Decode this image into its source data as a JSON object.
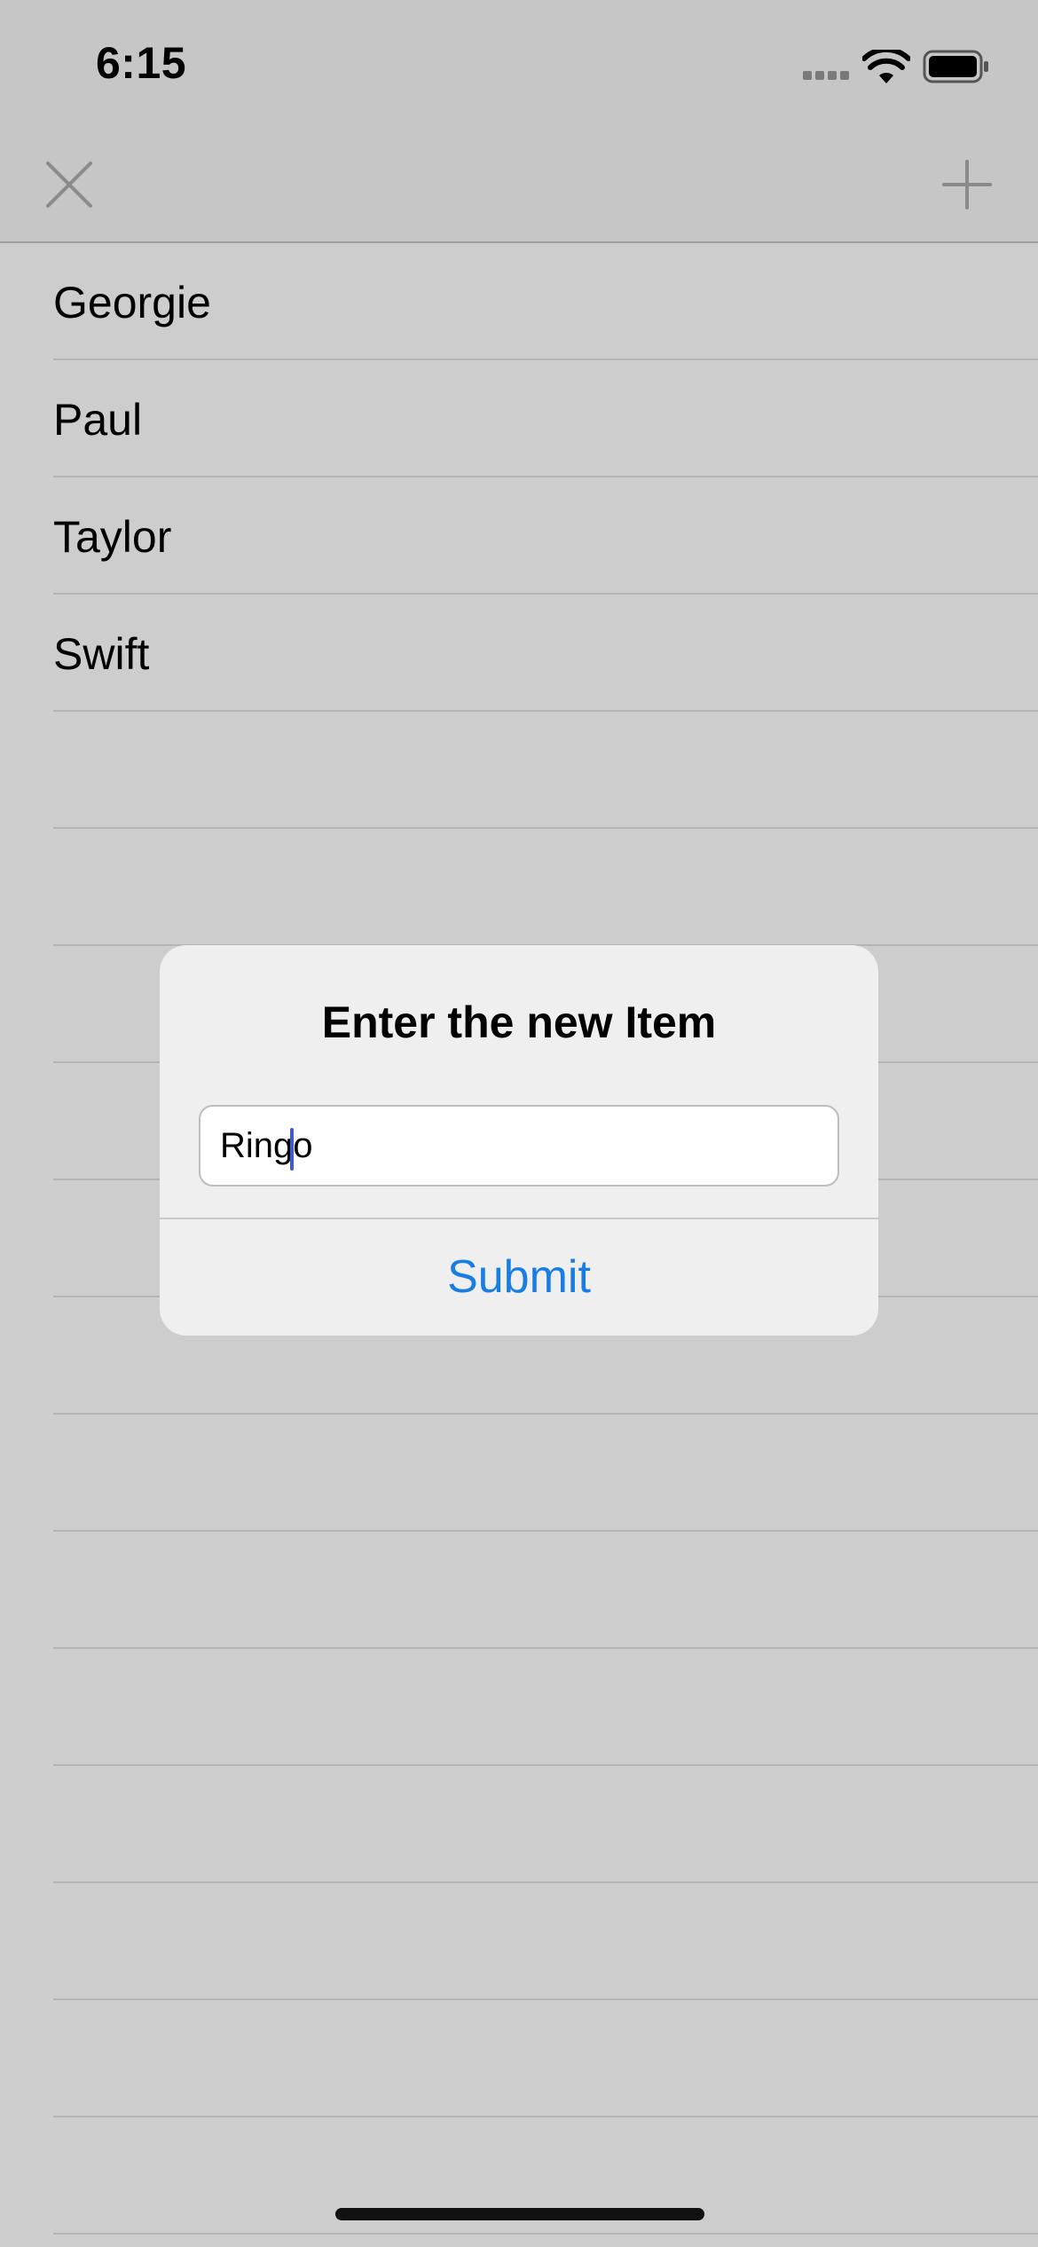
{
  "status_bar": {
    "time": "6:15",
    "signal_icon": "cellular-signal-icon",
    "wifi_icon": "wifi-icon",
    "battery_icon": "battery-icon"
  },
  "nav_bar": {
    "left_icon": "close-icon",
    "right_icon": "plus-icon"
  },
  "list": {
    "items": [
      "Georgie",
      "Paul",
      "Taylor",
      "Swift"
    ]
  },
  "alert": {
    "title": "Enter the new Item",
    "input_value": "Ringo",
    "submit_label": "Submit"
  },
  "colors": {
    "accent": "#1a7de3",
    "background": "#cdcdcd",
    "bar_background": "#c6c6c6",
    "alert_background": "#efefef",
    "caret": "#3d5bd9"
  }
}
